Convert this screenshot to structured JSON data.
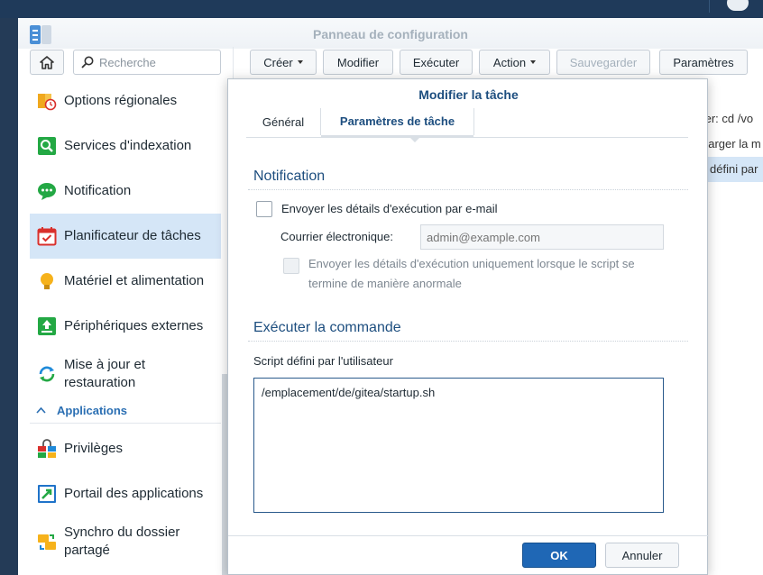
{
  "window": {
    "title": "Panneau de configuration"
  },
  "search": {
    "placeholder": "Recherche"
  },
  "toolbar": {
    "create_label": "Créer",
    "modify_label": "Modifier",
    "execute_label": "Exécuter",
    "action_label": "Action",
    "save_label": "Sauvegarder",
    "settings_label": "Paramètres"
  },
  "sidebar": {
    "items": [
      {
        "label": "Options régionales",
        "icon": "regional-options-icon"
      },
      {
        "label": "Services d'indexation",
        "icon": "indexing-service-icon"
      },
      {
        "label": "Notification",
        "icon": "notification-icon"
      },
      {
        "label": "Planificateur de tâches",
        "icon": "task-scheduler-icon",
        "active": true
      },
      {
        "label": "Matériel et alimentation",
        "icon": "hardware-power-icon"
      },
      {
        "label": "Périphériques externes",
        "icon": "external-devices-icon"
      },
      {
        "label": "Mise à jour et restauration",
        "icon": "update-restore-icon"
      }
    ],
    "section_label": "Applications",
    "app_items": [
      {
        "label": "Privilèges",
        "icon": "privileges-icon"
      },
      {
        "label": "Portail des applications",
        "icon": "application-portal-icon"
      },
      {
        "label": "Synchro du dossier partagé",
        "icon": "shared-folder-sync-icon"
      }
    ]
  },
  "background_list": {
    "rows": [
      "ter: cd /vo",
      "harger la m",
      "défini par"
    ]
  },
  "dialog": {
    "title": "Modifier la tâche",
    "tabs": [
      "Général",
      "Paramètres de tâche"
    ],
    "active_tab": "Paramètres de tâche",
    "notification": {
      "title": "Notification",
      "send_email_label": "Envoyer les détails d'exécution par e-mail",
      "send_email_checked": false,
      "email_label": "Courrier électronique:",
      "email_placeholder": "admin@example.com",
      "abnormal_only_label": "Envoyer les détails d'exécution uniquement lorsque le script se termine de manière anormale",
      "abnormal_only_checked": false
    },
    "command": {
      "title": "Exécuter la commande",
      "script_label": "Script défini par l'utilisateur",
      "script_value": "/emplacement/de/gitea/startup.sh"
    },
    "ok_label": "OK",
    "cancel_label": "Annuler"
  },
  "colors": {
    "accent": "#1f67b5",
    "title_blue": "#1d4e7f",
    "active_bg": "#d5e6f7"
  }
}
